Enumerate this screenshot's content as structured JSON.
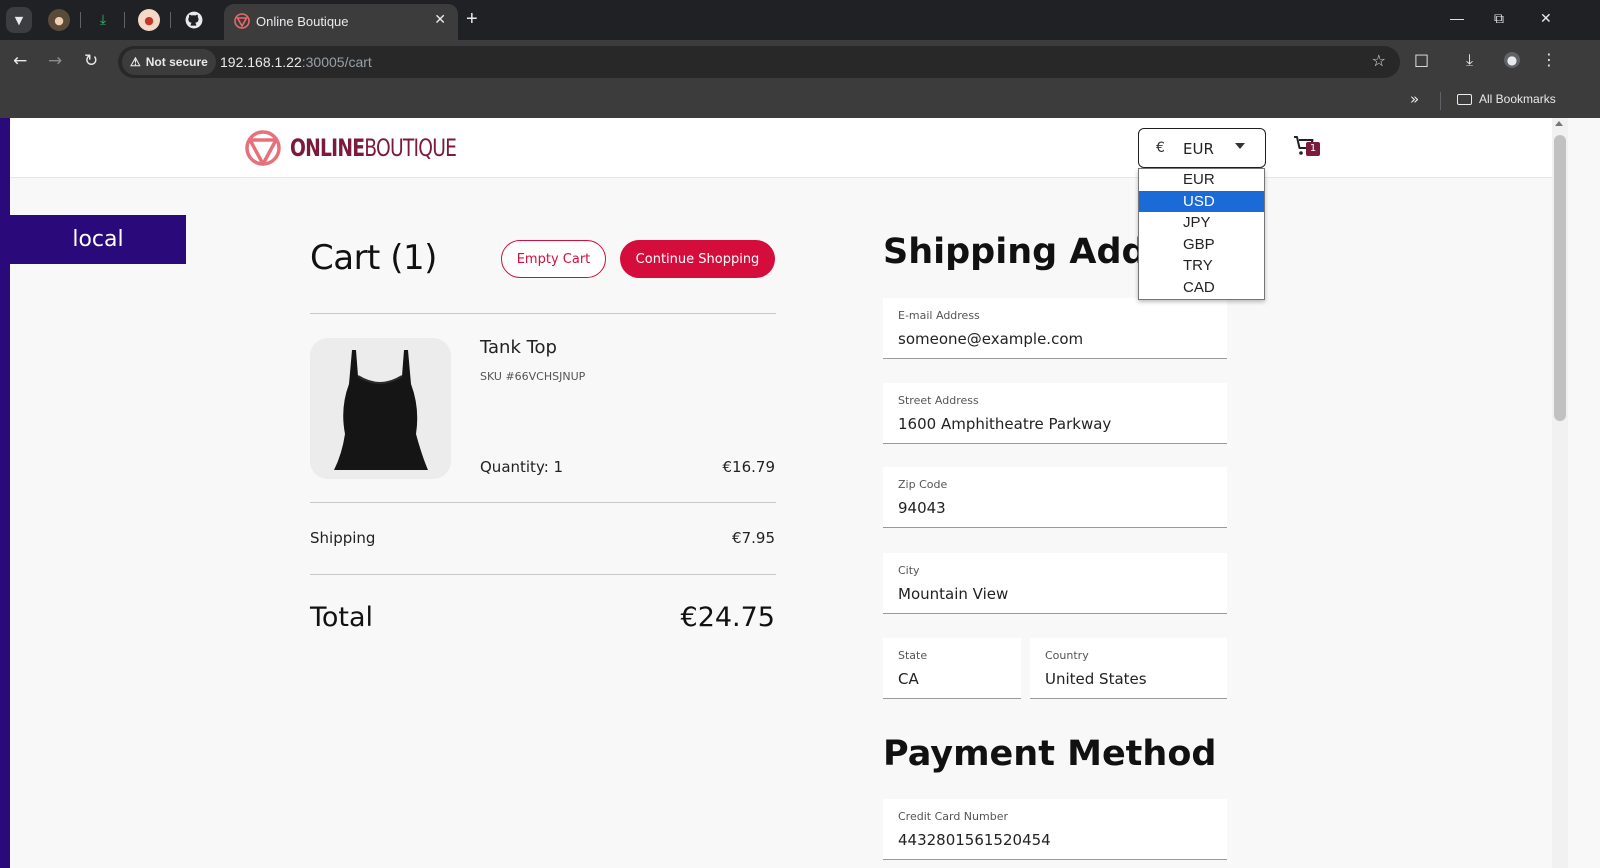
{
  "browser": {
    "active_tab_title": "Online Boutique",
    "url_host": "192.168.1.22",
    "url_path": ":30005/cart",
    "security_label": "Not secure",
    "bookmarks_label": "All Bookmarks"
  },
  "header": {
    "logo_bold": "ONLINE",
    "logo_light": "BOUTIQUE",
    "currency_symbol": "€",
    "currency_selected": "EUR",
    "cart_count": "1"
  },
  "currency_dropdown": {
    "options": [
      "EUR",
      "USD",
      "JPY",
      "GBP",
      "TRY",
      "CAD"
    ],
    "highlighted": "USD"
  },
  "env_badge": "local",
  "cart": {
    "title": "Cart (1)",
    "empty_button": "Empty Cart",
    "continue_button": "Continue Shopping",
    "item": {
      "name": "Tank Top",
      "sku": "SKU #66VCHSJNUP",
      "quantity": "Quantity: 1",
      "price": "€16.79"
    },
    "shipping_label": "Shipping",
    "shipping_value": "€7.95",
    "total_label": "Total",
    "total_value": "€24.75"
  },
  "shipping": {
    "title": "Shipping Address",
    "email_label": "E-mail Address",
    "email_value": "someone@example.com",
    "street_label": "Street Address",
    "street_value": "1600 Amphitheatre Parkway",
    "zip_label": "Zip Code",
    "zip_value": "94043",
    "city_label": "City",
    "city_value": "Mountain View",
    "state_label": "State",
    "state_value": "CA",
    "country_label": "Country",
    "country_value": "United States"
  },
  "payment": {
    "title": "Payment Method",
    "card_label": "Credit Card Number",
    "card_value": "4432801561520454"
  },
  "colors": {
    "brand_red": "#d50d3c",
    "brand_maroon": "#7a1b3b",
    "env_purple": "#2a0a7a",
    "select_highlight": "#1a6ad8"
  }
}
